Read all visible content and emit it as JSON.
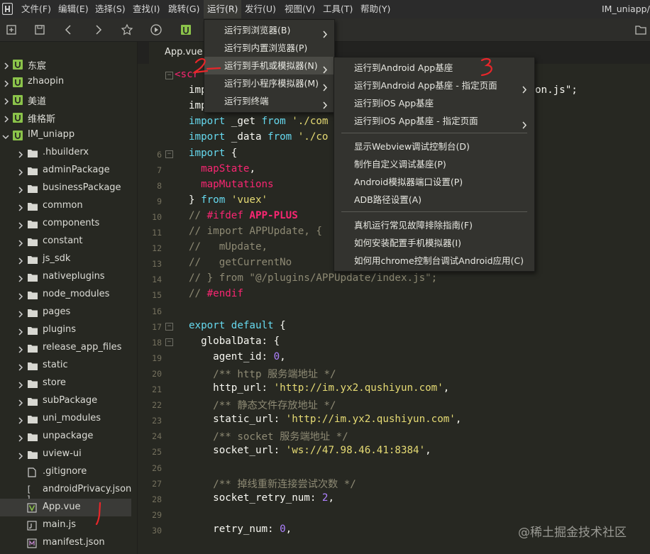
{
  "menubar": {
    "items": [
      "文件(F)",
      "编辑(E)",
      "选择(S)",
      "查找(I)",
      "跳转(G)",
      "运行(R)",
      "发行(U)",
      "视图(V)",
      "工具(T)",
      "帮助(Y)"
    ],
    "window_title": "IM_uniapp/"
  },
  "toolbar": {
    "icons": [
      "new-file-icon",
      "save-icon",
      "back-icon",
      "forward-icon",
      "favorite-icon",
      "run-icon",
      "project-icon",
      "folder-icon"
    ]
  },
  "sidebar": {
    "items": [
      {
        "label": "东宸",
        "type": "project"
      },
      {
        "label": "zhaopin",
        "type": "project"
      },
      {
        "label": "美道",
        "type": "project"
      },
      {
        "label": "维格斯",
        "type": "project"
      },
      {
        "label": "IM_uniapp",
        "type": "project-open"
      },
      {
        "label": ".hbuilderx",
        "type": "folder"
      },
      {
        "label": "adminPackage",
        "type": "folder"
      },
      {
        "label": "businessPackage",
        "type": "folder"
      },
      {
        "label": "common",
        "type": "folder"
      },
      {
        "label": "components",
        "type": "folder"
      },
      {
        "label": "constant",
        "type": "folder"
      },
      {
        "label": "js_sdk",
        "type": "folder"
      },
      {
        "label": "nativeplugins",
        "type": "folder"
      },
      {
        "label": "node_modules",
        "type": "folder"
      },
      {
        "label": "pages",
        "type": "folder"
      },
      {
        "label": "plugins",
        "type": "folder"
      },
      {
        "label": "release_app_files",
        "type": "folder"
      },
      {
        "label": "static",
        "type": "folder"
      },
      {
        "label": "store",
        "type": "folder"
      },
      {
        "label": "subPackage",
        "type": "folder"
      },
      {
        "label": "uni_modules",
        "type": "folder"
      },
      {
        "label": "unpackage",
        "type": "folder"
      },
      {
        "label": "uview-ui",
        "type": "folder"
      },
      {
        "label": ".gitignore",
        "type": "file"
      },
      {
        "label": "androidPrivacy.json",
        "type": "json"
      },
      {
        "label": "App.vue",
        "type": "vue"
      },
      {
        "label": "main.js",
        "type": "js"
      },
      {
        "label": "manifest.json",
        "type": "json"
      }
    ]
  },
  "tab": {
    "label": "App.vue"
  },
  "editor": {
    "lines": [
      {
        "n": "",
        "t": "<scr"
      },
      {
        "n": "",
        "t": "imp"
      },
      {
        "n": "",
        "t": "imp"
      },
      {
        "n": "",
        "t": "import _get from './com"
      },
      {
        "n": "",
        "t": "import _data from './co"
      },
      {
        "n": "6",
        "t": "import {"
      },
      {
        "n": "7",
        "t": "  mapState,"
      },
      {
        "n": "8",
        "t": "  mapMutations"
      },
      {
        "n": "9",
        "t": "} from 'vuex'"
      },
      {
        "n": "10",
        "t": "// #ifdef APP-PLUS"
      },
      {
        "n": "11",
        "t": "// import APPUpdate, {"
      },
      {
        "n": "12",
        "t": "//   mUpdate,"
      },
      {
        "n": "13",
        "t": "//   getCurrentNo"
      },
      {
        "n": "14",
        "t": "// } from \"@/plugins/APPUpdate/index.js\";"
      },
      {
        "n": "15",
        "t": "// #endif"
      },
      {
        "n": "16",
        "t": ""
      },
      {
        "n": "17",
        "t": "export default {"
      },
      {
        "n": "18",
        "t": "  globalData: {"
      },
      {
        "n": "19",
        "t": "    agent_id: 0,"
      },
      {
        "n": "20",
        "t": "    /** http 服务端地址 */"
      },
      {
        "n": "21",
        "t": "    http_url: 'http://im.yx2.qushiyun.com',"
      },
      {
        "n": "22",
        "t": "    /** 静态文件存放地址 */"
      },
      {
        "n": "23",
        "t": "    static_url: 'http://im.yx2.qushiyun.com',"
      },
      {
        "n": "24",
        "t": "    /** socket 服务端地址 */"
      },
      {
        "n": "25",
        "t": "    socket_url: 'ws://47.98.46.41:8384',"
      },
      {
        "n": "26",
        "t": ""
      },
      {
        "n": "27",
        "t": "    /** 掉线重新连接尝试次数 */"
      },
      {
        "n": "28",
        "t": "    socket_retry_num: 2,"
      },
      {
        "n": "29",
        "t": ""
      },
      {
        "n": "30",
        "t": "    retry_num: 0,"
      }
    ],
    "line2_tail": "on.js\";"
  },
  "run_menu": {
    "items": [
      {
        "label": "运行到浏览器(B)",
        "submenu": true
      },
      {
        "label": "运行到内置浏览器(P)",
        "submenu": false
      },
      {
        "label": "运行到手机或模拟器(N)",
        "submenu": true
      },
      {
        "label": "运行到小程序模拟器(M)",
        "submenu": true
      },
      {
        "label": "运行到终端",
        "submenu": true
      }
    ]
  },
  "device_menu": {
    "items": [
      {
        "label": "运行到Android App基座",
        "submenu": false
      },
      {
        "label": "运行到Android App基座 - 指定页面",
        "submenu": true
      },
      {
        "label": "运行到iOS App基座",
        "submenu": false
      },
      {
        "label": "运行到iOS App基座 - 指定页面",
        "submenu": true
      },
      {
        "label": "显示Webview调试控制台(D)",
        "submenu": false
      },
      {
        "label": "制作自定义调试基座(P)",
        "submenu": false
      },
      {
        "label": "Android模拟器端口设置(P)",
        "submenu": false
      },
      {
        "label": "ADB路径设置(A)",
        "submenu": false
      },
      {
        "label": "真机运行常见故障排除指南(F)",
        "submenu": false
      },
      {
        "label": "如何安装配置手机模拟器(I)",
        "submenu": false
      },
      {
        "label": "如何用chrome控制台调试Android应用(C)",
        "submenu": false
      }
    ]
  },
  "annotations": [
    "1",
    "2",
    "3"
  ],
  "watermark": "@稀土掘金技术社区",
  "colors": {
    "accent": "#8bc34a",
    "annotation": "#e8262a",
    "keyword": "#66d9ef",
    "string": "#e6db74",
    "comment": "#8e8a74",
    "number": "#ae81ff",
    "tag": "#f92672"
  }
}
